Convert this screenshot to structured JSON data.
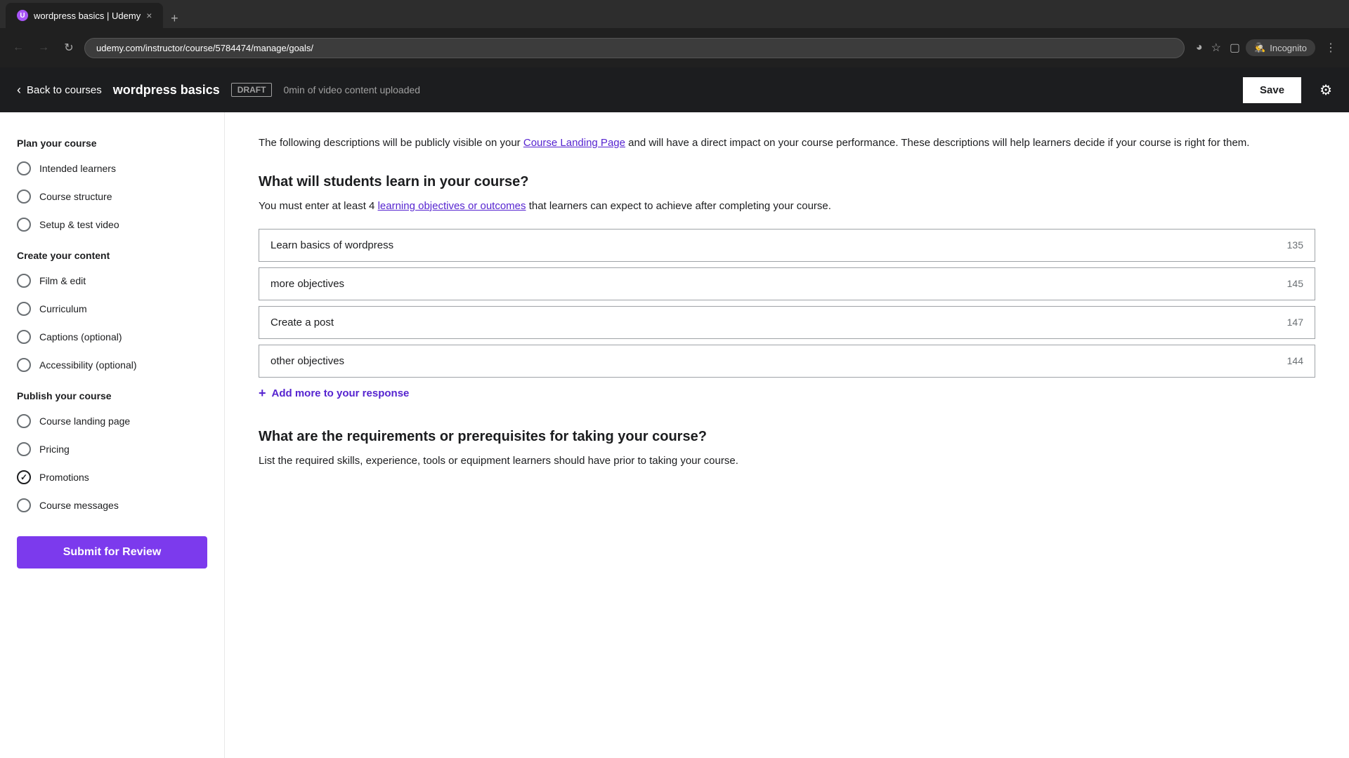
{
  "browser": {
    "tab_title": "wordpress basics | Udemy",
    "tab_close": "×",
    "new_tab": "+",
    "address": "udemy.com/instructor/course/5784474/manage/goals/",
    "back_disabled": true,
    "forward_disabled": true,
    "incognito_label": "Incognito"
  },
  "header": {
    "back_label": "Back to courses",
    "course_title": "wordpress basics",
    "draft_label": "DRAFT",
    "video_info": "0min of video content uploaded",
    "save_label": "Save"
  },
  "sidebar": {
    "plan_section": "Plan your course",
    "intended_learners": "Intended learners",
    "course_structure": "Course structure",
    "setup_test_video": "Setup & test video",
    "create_section": "Create your content",
    "film_edit": "Film & edit",
    "curriculum": "Curriculum",
    "captions": "Captions (optional)",
    "accessibility": "Accessibility (optional)",
    "publish_section": "Publish your course",
    "course_landing": "Course landing page",
    "pricing": "Pricing",
    "promotions": "Promotions",
    "course_messages": "Course messages",
    "submit_label": "Submit for Review",
    "promotions_checked": true
  },
  "content": {
    "description": "The following descriptions will be publicly visible on your",
    "landing_page_link": "Course Landing Page",
    "description2": "and will have a direct impact on your course performance. These descriptions will help learners decide if your course is right for them.",
    "objectives_title": "What will students learn in your course?",
    "objectives_subtitle_1": "You must enter at least 4",
    "objectives_link": "learning objectives or outcomes",
    "objectives_subtitle_2": "that learners can expect to achieve after completing your course.",
    "objectives": [
      {
        "value": "Learn basics of wordpress",
        "count": "135"
      },
      {
        "value": "more objectives",
        "count": "145"
      },
      {
        "value": "Create a post",
        "count": "147"
      },
      {
        "value": "other objectives",
        "count": "144"
      }
    ],
    "add_more_label": "Add more to your response",
    "requirements_title": "What are the requirements or prerequisites for taking your course?",
    "requirements_text": "List the required skills, experience, tools or equipment learners should have prior to taking your course."
  }
}
